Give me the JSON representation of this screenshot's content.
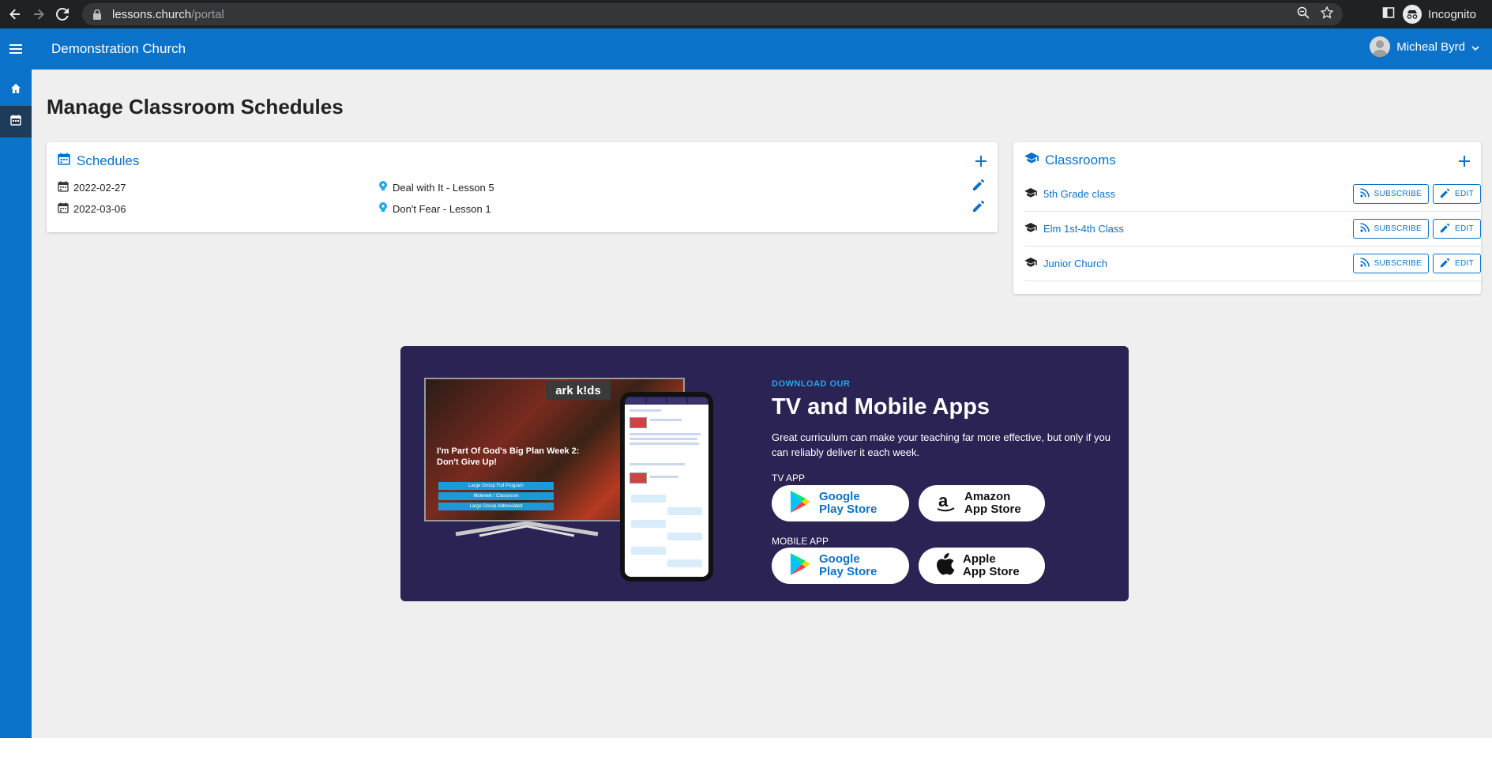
{
  "browser": {
    "url_host": "lessons.church",
    "url_path": "/portal",
    "profile_label": "Incognito"
  },
  "header": {
    "church_name": "Demonstration Church",
    "user_name": "Micheal Byrd"
  },
  "page": {
    "title": "Manage Classroom Schedules"
  },
  "schedules": {
    "title": "Schedules",
    "rows": [
      {
        "date": "2022-02-27",
        "lesson": "Deal with It - Lesson 5"
      },
      {
        "date": "2022-03-06",
        "lesson": "Don't Fear - Lesson 1"
      }
    ]
  },
  "classrooms": {
    "title": "Classrooms",
    "subscribe_label": "SUBSCRIBE",
    "edit_label": "EDIT",
    "rows": [
      {
        "name": "5th Grade class"
      },
      {
        "name": "Elm 1st-4th Class"
      },
      {
        "name": "Junior Church"
      }
    ]
  },
  "promo": {
    "kicker": "DOWNLOAD OUR",
    "title": "TV and Mobile Apps",
    "description": "Great curriculum can make your teaching far more effective, but only if you can reliably deliver it each week.",
    "tv_label": "TV APP",
    "mobile_label": "MOBILE APP",
    "google_line1": "Google",
    "google_line2": "Play Store",
    "amazon_line1": "Amazon",
    "amazon_line2": "App Store",
    "apple_line1": "Apple",
    "apple_line2": "App Store",
    "tv_logo": "ark k!ds",
    "tv_caption_1": "I'm Part Of God's Big Plan Week 2:",
    "tv_caption_2": "Don't Give Up!",
    "tv_buttons": [
      "Large Group Full Program",
      "Midweek / Classroom",
      "Large Group Abbreviated"
    ]
  },
  "colors": {
    "primary": "#0b72c9",
    "promo_bg": "#2a2354",
    "accent": "#22a7e8"
  }
}
